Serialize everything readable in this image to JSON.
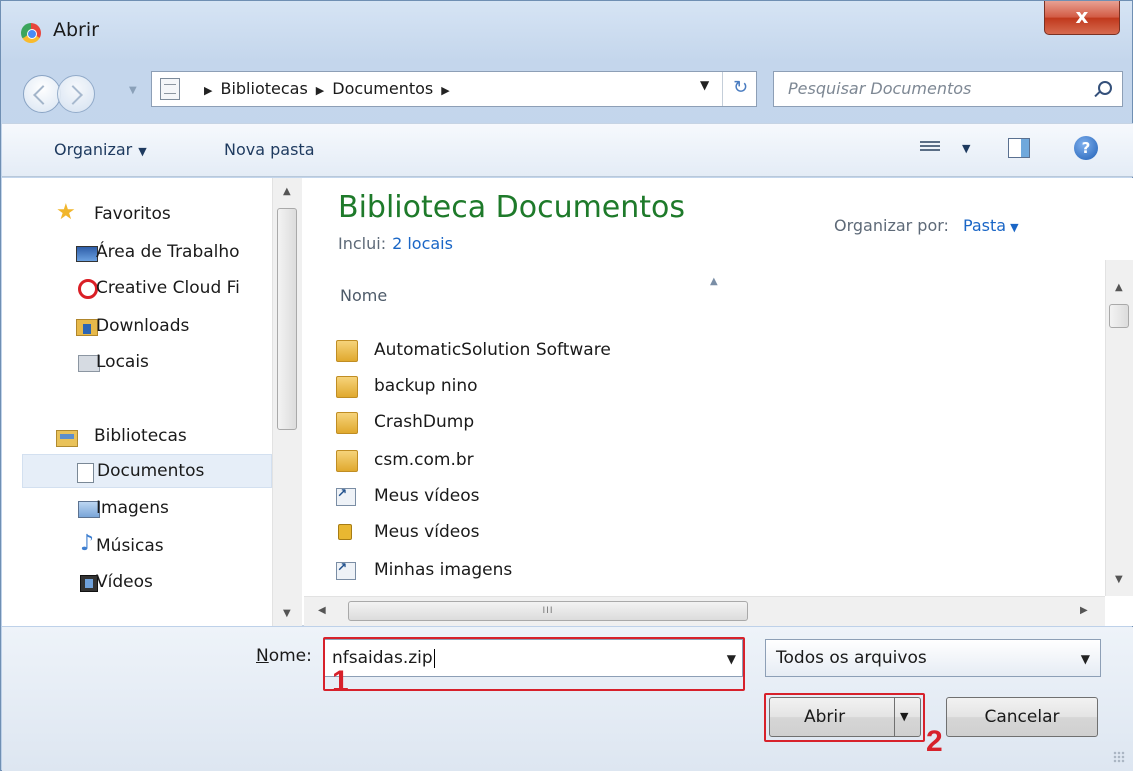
{
  "window": {
    "title": "Abrir",
    "close": "x"
  },
  "nav": {
    "path": [
      "Bibliotecas",
      "Documentos"
    ],
    "search_placeholder": "Pesquisar Documentos"
  },
  "toolbar": {
    "organizar": "Organizar",
    "nova_pasta": "Nova pasta",
    "help": "?"
  },
  "sidebar": {
    "favoritos": "Favoritos",
    "favorites": [
      "Área de Trabalho",
      "Creative Cloud Fi",
      "Downloads",
      "Locais"
    ],
    "bibliotecas": "Bibliotecas",
    "libraries": [
      "Documentos",
      "Imagens",
      "Músicas",
      "Vídeos"
    ],
    "selected": "Documentos"
  },
  "library": {
    "title": "Biblioteca Documentos",
    "inclui_label": "Inclui:",
    "inclui_link": "2 locais",
    "organizar_por_label": "Organizar por:",
    "organizar_por_value": "Pasta"
  },
  "columns": {
    "nome": "Nome"
  },
  "files": [
    {
      "name": "AutomaticSolution Software",
      "icon": "folder-icon"
    },
    {
      "name": "backup nino",
      "icon": "folder-icon"
    },
    {
      "name": "CrashDump",
      "icon": "folder-icon"
    },
    {
      "name": "csm.com.br",
      "icon": "folder-icon"
    },
    {
      "name": "Meus vídeos",
      "icon": "shortcut-icon"
    },
    {
      "name": "Meus vídeos",
      "icon": "lock-icon"
    },
    {
      "name": "Minhas imagens",
      "icon": "shortcut-icon"
    }
  ],
  "hscroll_grip": "III",
  "footer": {
    "name_label_u": "N",
    "name_label_rest": "ome:",
    "name_value": "nfsaidas.zip",
    "filetype_value": "Todos os arquivos",
    "open_label": "Abrir",
    "cancel_label": "Cancelar"
  },
  "annotations": {
    "one": "1",
    "two": "2",
    "color": "#d7212b"
  },
  "colors": {
    "library_title": "#1e7a2a",
    "link": "#1a66c6",
    "selection": "#e6eef8"
  }
}
